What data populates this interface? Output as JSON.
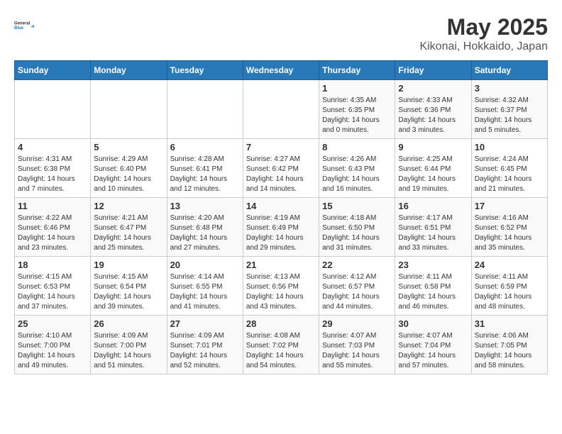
{
  "logo": {
    "line1": "General",
    "line2": "Blue"
  },
  "title": "May 2025",
  "subtitle": "Kikonai, Hokkaido, Japan",
  "days_of_week": [
    "Sunday",
    "Monday",
    "Tuesday",
    "Wednesday",
    "Thursday",
    "Friday",
    "Saturday"
  ],
  "weeks": [
    [
      {
        "day": "",
        "info": ""
      },
      {
        "day": "",
        "info": ""
      },
      {
        "day": "",
        "info": ""
      },
      {
        "day": "",
        "info": ""
      },
      {
        "day": "1",
        "info": "Sunrise: 4:35 AM\nSunset: 6:35 PM\nDaylight: 14 hours\nand 0 minutes."
      },
      {
        "day": "2",
        "info": "Sunrise: 4:33 AM\nSunset: 6:36 PM\nDaylight: 14 hours\nand 3 minutes."
      },
      {
        "day": "3",
        "info": "Sunrise: 4:32 AM\nSunset: 6:37 PM\nDaylight: 14 hours\nand 5 minutes."
      }
    ],
    [
      {
        "day": "4",
        "info": "Sunrise: 4:31 AM\nSunset: 6:38 PM\nDaylight: 14 hours\nand 7 minutes."
      },
      {
        "day": "5",
        "info": "Sunrise: 4:29 AM\nSunset: 6:40 PM\nDaylight: 14 hours\nand 10 minutes."
      },
      {
        "day": "6",
        "info": "Sunrise: 4:28 AM\nSunset: 6:41 PM\nDaylight: 14 hours\nand 12 minutes."
      },
      {
        "day": "7",
        "info": "Sunrise: 4:27 AM\nSunset: 6:42 PM\nDaylight: 14 hours\nand 14 minutes."
      },
      {
        "day": "8",
        "info": "Sunrise: 4:26 AM\nSunset: 6:43 PM\nDaylight: 14 hours\nand 16 minutes."
      },
      {
        "day": "9",
        "info": "Sunrise: 4:25 AM\nSunset: 6:44 PM\nDaylight: 14 hours\nand 19 minutes."
      },
      {
        "day": "10",
        "info": "Sunrise: 4:24 AM\nSunset: 6:45 PM\nDaylight: 14 hours\nand 21 minutes."
      }
    ],
    [
      {
        "day": "11",
        "info": "Sunrise: 4:22 AM\nSunset: 6:46 PM\nDaylight: 14 hours\nand 23 minutes."
      },
      {
        "day": "12",
        "info": "Sunrise: 4:21 AM\nSunset: 6:47 PM\nDaylight: 14 hours\nand 25 minutes."
      },
      {
        "day": "13",
        "info": "Sunrise: 4:20 AM\nSunset: 6:48 PM\nDaylight: 14 hours\nand 27 minutes."
      },
      {
        "day": "14",
        "info": "Sunrise: 4:19 AM\nSunset: 6:49 PM\nDaylight: 14 hours\nand 29 minutes."
      },
      {
        "day": "15",
        "info": "Sunrise: 4:18 AM\nSunset: 6:50 PM\nDaylight: 14 hours\nand 31 minutes."
      },
      {
        "day": "16",
        "info": "Sunrise: 4:17 AM\nSunset: 6:51 PM\nDaylight: 14 hours\nand 33 minutes."
      },
      {
        "day": "17",
        "info": "Sunrise: 4:16 AM\nSunset: 6:52 PM\nDaylight: 14 hours\nand 35 minutes."
      }
    ],
    [
      {
        "day": "18",
        "info": "Sunrise: 4:15 AM\nSunset: 6:53 PM\nDaylight: 14 hours\nand 37 minutes."
      },
      {
        "day": "19",
        "info": "Sunrise: 4:15 AM\nSunset: 6:54 PM\nDaylight: 14 hours\nand 39 minutes."
      },
      {
        "day": "20",
        "info": "Sunrise: 4:14 AM\nSunset: 6:55 PM\nDaylight: 14 hours\nand 41 minutes."
      },
      {
        "day": "21",
        "info": "Sunrise: 4:13 AM\nSunset: 6:56 PM\nDaylight: 14 hours\nand 43 minutes."
      },
      {
        "day": "22",
        "info": "Sunrise: 4:12 AM\nSunset: 6:57 PM\nDaylight: 14 hours\nand 44 minutes."
      },
      {
        "day": "23",
        "info": "Sunrise: 4:11 AM\nSunset: 6:58 PM\nDaylight: 14 hours\nand 46 minutes."
      },
      {
        "day": "24",
        "info": "Sunrise: 4:11 AM\nSunset: 6:59 PM\nDaylight: 14 hours\nand 48 minutes."
      }
    ],
    [
      {
        "day": "25",
        "info": "Sunrise: 4:10 AM\nSunset: 7:00 PM\nDaylight: 14 hours\nand 49 minutes."
      },
      {
        "day": "26",
        "info": "Sunrise: 4:09 AM\nSunset: 7:00 PM\nDaylight: 14 hours\nand 51 minutes."
      },
      {
        "day": "27",
        "info": "Sunrise: 4:09 AM\nSunset: 7:01 PM\nDaylight: 14 hours\nand 52 minutes."
      },
      {
        "day": "28",
        "info": "Sunrise: 4:08 AM\nSunset: 7:02 PM\nDaylight: 14 hours\nand 54 minutes."
      },
      {
        "day": "29",
        "info": "Sunrise: 4:07 AM\nSunset: 7:03 PM\nDaylight: 14 hours\nand 55 minutes."
      },
      {
        "day": "30",
        "info": "Sunrise: 4:07 AM\nSunset: 7:04 PM\nDaylight: 14 hours\nand 57 minutes."
      },
      {
        "day": "31",
        "info": "Sunrise: 4:06 AM\nSunset: 7:05 PM\nDaylight: 14 hours\nand 58 minutes."
      }
    ]
  ]
}
